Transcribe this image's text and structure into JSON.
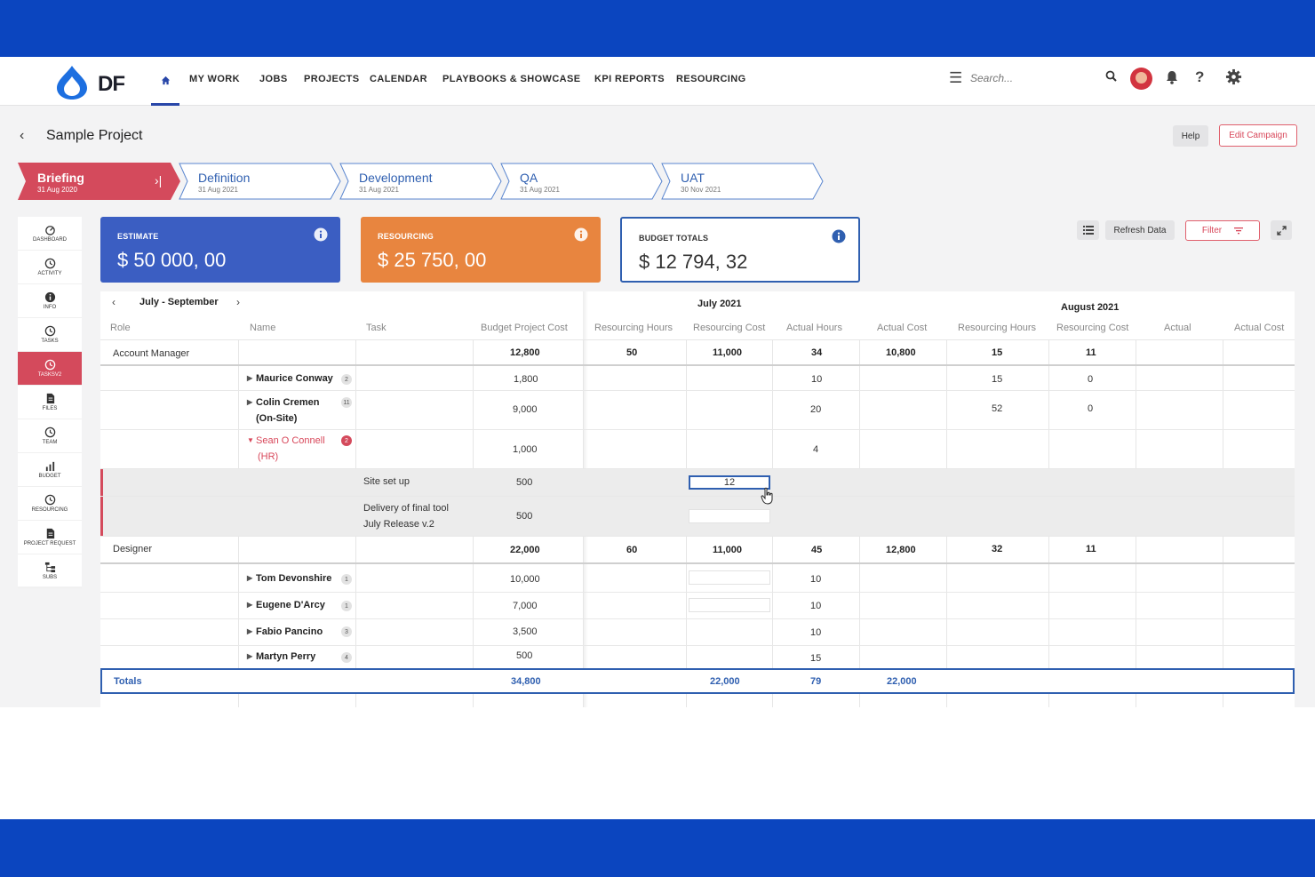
{
  "app": {
    "logo_text": "DF"
  },
  "nav": {
    "items": [
      "MY WORK",
      "JOBS",
      "PROJECTS",
      "CALENDAR",
      "PLAYBOOKS & SHOWCASE",
      "KPI REPORTS",
      "RESOURCING"
    ],
    "search_placeholder": "Search...",
    "help_glyph": "?"
  },
  "header": {
    "title": "Sample Project",
    "help_label": "Help",
    "edit_label": "Edit Campaign"
  },
  "stages": [
    {
      "name": "Briefing",
      "date": "31 Aug 2020",
      "active": true
    },
    {
      "name": "Definition",
      "date": "31 Aug 2021"
    },
    {
      "name": "Development",
      "date": "31 Aug 2021"
    },
    {
      "name": "QA",
      "date": "31 Aug 2021"
    },
    {
      "name": "UAT",
      "date": "30 Nov 2021"
    }
  ],
  "sidenav": [
    {
      "label": "DASHBOARD",
      "icon": "dashboard-icon"
    },
    {
      "label": "ACTIVITY",
      "icon": "clock-icon"
    },
    {
      "label": "INFO",
      "icon": "info-icon"
    },
    {
      "label": "TASKS",
      "icon": "clock-icon"
    },
    {
      "label": "TASKSV2",
      "icon": "clock-icon",
      "active": true
    },
    {
      "label": "FILES",
      "icon": "file-icon"
    },
    {
      "label": "TEAM",
      "icon": "clock-icon"
    },
    {
      "label": "BUDGET",
      "icon": "chart-icon"
    },
    {
      "label": "RESOURCING",
      "icon": "clock-icon"
    },
    {
      "label": "PROJECT REQUEST",
      "icon": "file-icon"
    },
    {
      "label": "SUBS",
      "icon": "hierarchy-icon"
    }
  ],
  "cards": {
    "estimate": {
      "label": "ESTIMATE",
      "value": "$ 50 000, 00"
    },
    "resourcing": {
      "label": "RESOURCING",
      "value": "$ 25 750, 00"
    },
    "budget": {
      "label": "BUDGET TOTALS",
      "value": "$ 12 794, 32"
    }
  },
  "toolbar": {
    "refresh_label": "Refresh Data",
    "filter_label": "Filter"
  },
  "grid": {
    "period": "July - September",
    "months": [
      "July 2021",
      "August 2021"
    ],
    "headers": {
      "role": "Role",
      "name": "Name",
      "task": "Task",
      "budget": "Budget Project Cost",
      "res_hours": "Resourcing Hours",
      "res_cost": "Resourcing Cost",
      "act_hours": "Actual Hours",
      "act_cost": "Actual Cost",
      "res_hours2": "Resourcing Hours",
      "res_cost2": "Resourcing Cost",
      "actual2": "Actual",
      "act_cost2": "Actual Cost"
    },
    "rows": {
      "am": {
        "role": "Account Manager",
        "budget": "12,800",
        "jul_rh": "50",
        "jul_rc": "11,000",
        "jul_ah": "34",
        "jul_ac": "10,800",
        "aug_rh": "15",
        "aug_rc": "11"
      },
      "maurice": {
        "name": "Maurice Conway",
        "badge": "2",
        "budget": "1,800",
        "jul_ah": "10",
        "aug_rh": "15",
        "aug_rc": "0"
      },
      "colin": {
        "name": "Colin Cremen",
        "name2": "(On-Site)",
        "badge": "11",
        "budget": "9,000",
        "jul_ah": "20",
        "aug_rh": "52",
        "aug_rc": "0"
      },
      "sean": {
        "name": "Sean O Connell",
        "name2": "(HR)",
        "badge": "2",
        "budget": "1,000",
        "jul_ah": "4"
      },
      "task1": {
        "task": "Site set up",
        "budget": "500",
        "edit_value": "12"
      },
      "task2": {
        "task": "Delivery of final tool",
        "task2": "July Release v.2",
        "budget": "500"
      },
      "designer": {
        "role": "Designer",
        "budget": "22,000",
        "jul_rh": "60",
        "jul_rc": "11,000",
        "jul_ah": "45",
        "jul_ac": "12,800",
        "aug_rh": "32",
        "aug_rc": "11"
      },
      "tom": {
        "name": "Tom Devonshire",
        "badge": "1",
        "budget": "10,000",
        "jul_ah": "10"
      },
      "eugene": {
        "name": "Eugene D'Arcy",
        "badge": "1",
        "budget": "7,000",
        "jul_ah": "10"
      },
      "fabio": {
        "name": "Fabio Pancino",
        "badge": "3",
        "budget": "3,500",
        "jul_ah": "10"
      },
      "martyn": {
        "name": "Martyn Perry",
        "badge": "4",
        "budget": "500",
        "jul_ah": "15"
      }
    },
    "totals": {
      "label": "Totals",
      "budget": "34,800",
      "jul_rc": "22,000",
      "jul_ah": "79",
      "jul_ac": "22,000"
    }
  },
  "colors": {
    "brand_blue": "#0b45bf",
    "accent_red": "#d44a5c",
    "estimate_blue": "#3b5ec2",
    "resourcing_orange": "#e8853f",
    "link_blue": "#2f5fb0"
  }
}
